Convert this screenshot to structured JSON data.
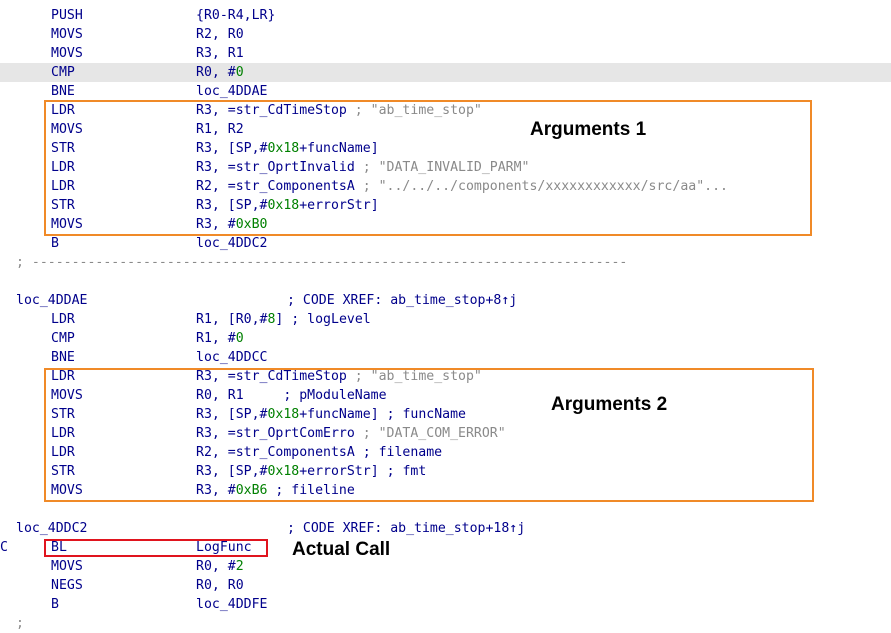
{
  "lines": [
    {
      "mn": "PUSH",
      "ops": [
        {
          "t": "{R0-R4,LR}",
          "c": "blue"
        }
      ]
    },
    {
      "mn": "MOVS",
      "ops": [
        {
          "t": "R2, R0",
          "c": "blue"
        }
      ]
    },
    {
      "mn": "MOVS",
      "ops": [
        {
          "t": "R3, R1",
          "c": "blue"
        }
      ]
    },
    {
      "mn": "CMP",
      "ops": [
        {
          "t": "R0, #",
          "c": "blue"
        },
        {
          "t": "0",
          "c": "green"
        }
      ],
      "highlight": true
    },
    {
      "mn": "BNE",
      "ops": [
        {
          "t": "loc_4DDAE",
          "c": "blue"
        }
      ]
    },
    {
      "mn": "LDR",
      "ops": [
        {
          "t": "R3, =str_CdTimeStop ",
          "c": "blue"
        },
        {
          "t": "; \"ab_time_stop\"",
          "c": "gray"
        }
      ]
    },
    {
      "mn": "MOVS",
      "ops": [
        {
          "t": "R1, R2",
          "c": "blue"
        }
      ]
    },
    {
      "mn": "STR",
      "ops": [
        {
          "t": "R3, [SP,#",
          "c": "blue"
        },
        {
          "t": "0x18",
          "c": "green"
        },
        {
          "t": "+funcName]",
          "c": "blue"
        }
      ]
    },
    {
      "mn": "LDR",
      "ops": [
        {
          "t": "R3, =str_OprtInvalid ",
          "c": "blue"
        },
        {
          "t": "; \"DATA_INVALID_PARM\"",
          "c": "gray"
        }
      ]
    },
    {
      "mn": "LDR",
      "ops": [
        {
          "t": "R2, =str_ComponentsA ",
          "c": "blue"
        },
        {
          "t": "; \"../../../components/xxxxxxxxxxxx/src/aa\"...",
          "c": "gray"
        }
      ]
    },
    {
      "mn": "STR",
      "ops": [
        {
          "t": "R3, [SP,#",
          "c": "blue"
        },
        {
          "t": "0x18",
          "c": "green"
        },
        {
          "t": "+errorStr]",
          "c": "blue"
        }
      ]
    },
    {
      "mn": "MOVS",
      "ops": [
        {
          "t": "R3, #",
          "c": "blue"
        },
        {
          "t": "0xB0",
          "c": "green"
        }
      ]
    },
    {
      "mn": "B",
      "ops": [
        {
          "t": "loc_4DDC2",
          "c": "blue"
        }
      ]
    },
    {
      "separator": "; ---------------------------------------------------------------------------"
    },
    {
      "blank": true
    },
    {
      "label": "loc_4DDAE",
      "xref": "; CODE XREF: ab_time_stop+8↑j"
    },
    {
      "mn": "LDR",
      "ops": [
        {
          "t": "R1, [R0,#",
          "c": "blue"
        },
        {
          "t": "8",
          "c": "green"
        },
        {
          "t": "] ; logLevel",
          "c": "blue"
        }
      ]
    },
    {
      "mn": "CMP",
      "ops": [
        {
          "t": "R1, #",
          "c": "blue"
        },
        {
          "t": "0",
          "c": "green"
        }
      ]
    },
    {
      "mn": "BNE",
      "ops": [
        {
          "t": "loc_4DDCC",
          "c": "blue"
        }
      ]
    },
    {
      "mn": "LDR",
      "ops": [
        {
          "t": "R3, =str_CdTimeStop ",
          "c": "blue"
        },
        {
          "t": "; \"ab_time_stop\"",
          "c": "gray"
        }
      ]
    },
    {
      "mn": "MOVS",
      "ops": [
        {
          "t": "R0, R1     ; pModuleName",
          "c": "blue"
        }
      ]
    },
    {
      "mn": "STR",
      "ops": [
        {
          "t": "R3, [SP,#",
          "c": "blue"
        },
        {
          "t": "0x18",
          "c": "green"
        },
        {
          "t": "+funcName] ; funcName",
          "c": "blue"
        }
      ]
    },
    {
      "mn": "LDR",
      "ops": [
        {
          "t": "R3, =str_OprtComErro ",
          "c": "blue"
        },
        {
          "t": "; \"DATA_COM_ERROR\"",
          "c": "gray"
        }
      ]
    },
    {
      "mn": "LDR",
      "ops": [
        {
          "t": "R2, =str_ComponentsA ; filename",
          "c": "blue"
        }
      ]
    },
    {
      "mn": "STR",
      "ops": [
        {
          "t": "R3, [SP,#",
          "c": "blue"
        },
        {
          "t": "0x18",
          "c": "green"
        },
        {
          "t": "+errorStr] ; fmt",
          "c": "blue"
        }
      ]
    },
    {
      "mn": "MOVS",
      "ops": [
        {
          "t": "R3, #",
          "c": "blue"
        },
        {
          "t": "0xB6",
          "c": "green"
        },
        {
          "t": " ; fileline",
          "c": "blue"
        }
      ]
    },
    {
      "blank": true
    },
    {
      "label": "loc_4DDC2",
      "xref": "; CODE XREF: ab_time_stop+18↑j"
    },
    {
      "mn": "BL",
      "ops": [
        {
          "t": "LogFunc",
          "c": "blue"
        }
      ],
      "side": "C"
    },
    {
      "mn": "MOVS",
      "ops": [
        {
          "t": "R0, #",
          "c": "blue"
        },
        {
          "t": "2",
          "c": "green"
        }
      ]
    },
    {
      "mn": "NEGS",
      "ops": [
        {
          "t": "R0, R0",
          "c": "blue"
        }
      ]
    },
    {
      "mn": "B",
      "ops": [
        {
          "t": "loc_4DDFE",
          "c": "blue"
        }
      ]
    },
    {
      "tail": ";"
    }
  ],
  "annotations": {
    "arguments1": "Arguments 1",
    "arguments2": "Arguments 2",
    "actual_call": "Actual Call"
  }
}
